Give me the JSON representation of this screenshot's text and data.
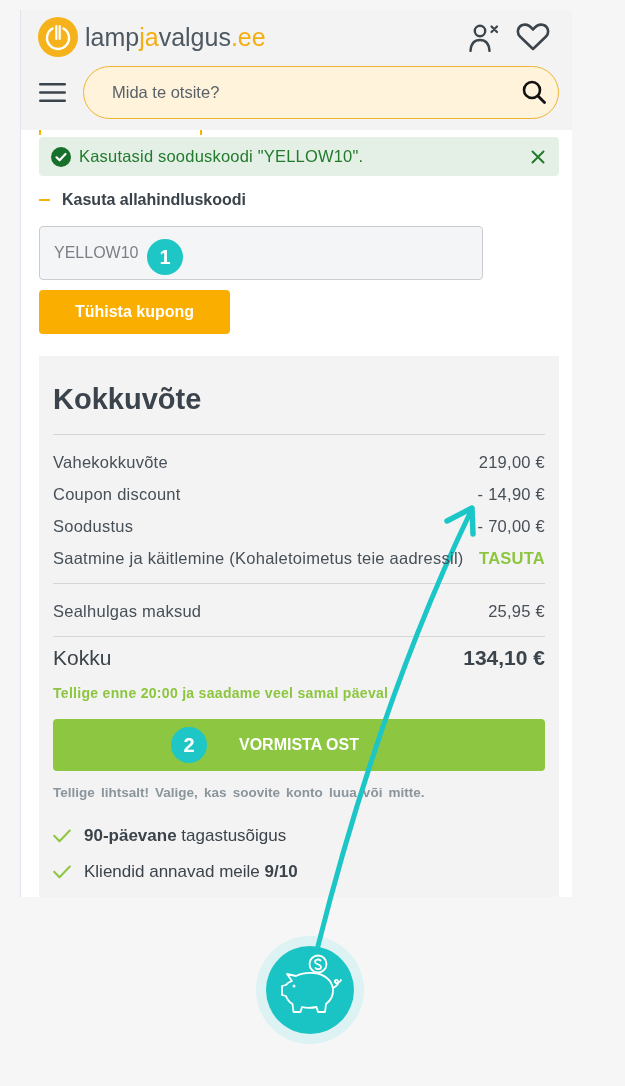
{
  "header": {
    "logo": [
      {
        "text": "lamp",
        "accent": false
      },
      {
        "text": "ja",
        "accent": true
      },
      {
        "text": "valgus",
        "accent": false
      },
      {
        "text": ".ee",
        "accent": true
      }
    ],
    "search": {
      "placeholder": "Mida te otsite?"
    }
  },
  "alert": {
    "kind": "success",
    "message": "Kasutasid sooduskoodi \"YELLOW10\"."
  },
  "coupon": {
    "heading": "Kasuta allahindluskoodi",
    "expanded": true,
    "value": "YELLOW10",
    "disabled": true,
    "marker": "1",
    "button": "Tühista kupong"
  },
  "summary": {
    "title": "Kokkuvõte",
    "sections": [
      {
        "rows": [
          {
            "kind": "plain",
            "label": "Vahekokkuvõte",
            "value": "219,00 €"
          },
          {
            "kind": "plain",
            "label": "Coupon discount",
            "value": "- 14,90 €"
          },
          {
            "kind": "plain",
            "label": "Soodustus",
            "value": "- 70,00 €"
          },
          {
            "kind": "free",
            "label": "Saatmine ja käitlemine (Kohaletoimetus teie aadressil)",
            "value": "TASUTA"
          }
        ]
      },
      {
        "rows": [
          {
            "kind": "plain",
            "label": "Sealhulgas maksud",
            "value": "25,95 €"
          }
        ]
      },
      {
        "rows": [
          {
            "kind": "total",
            "label": "Kokku",
            "value": "134,10 €"
          }
        ]
      }
    ],
    "delivery_note": "Tellige enne 20:00 ja saadame veel samal päeval",
    "checkout": {
      "label": "VORMISTA OST",
      "marker": "2"
    },
    "account_note": "Tellige lihtsalt! Valige, kas soovite konto luua või mitte.",
    "benefits": [
      "**90-päevane** tagastusõigus",
      "Kliendid annavad meile **9/10**"
    ]
  }
}
